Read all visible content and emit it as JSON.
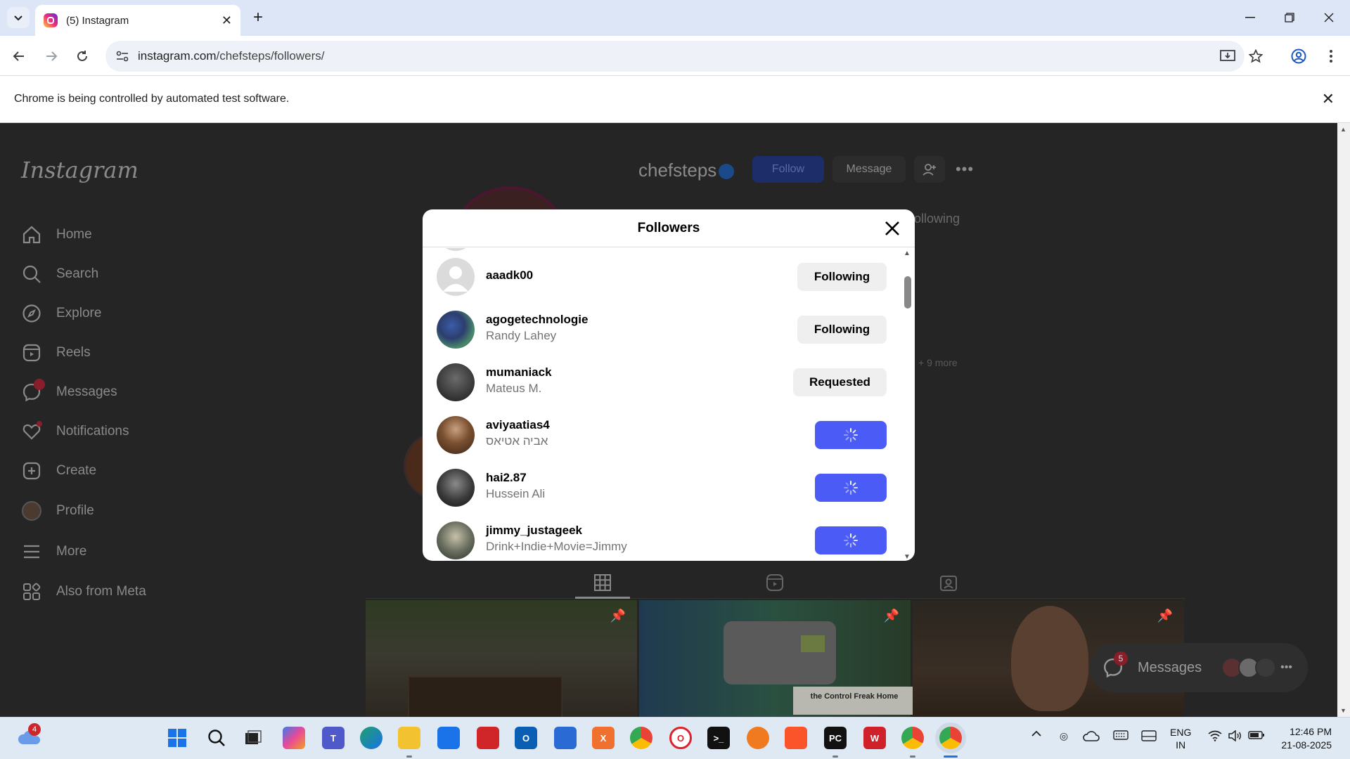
{
  "browser": {
    "tab_title": "(5) Instagram",
    "url_host": "instagram.com",
    "url_path": "/chefsteps/followers/",
    "infobar_text": "Chrome is being controlled by automated test software."
  },
  "instagram": {
    "logo": "Instagram",
    "nav": [
      {
        "label": "Home",
        "icon": "home-icon"
      },
      {
        "label": "Search",
        "icon": "search-icon"
      },
      {
        "label": "Explore",
        "icon": "compass-icon"
      },
      {
        "label": "Reels",
        "icon": "reels-icon"
      },
      {
        "label": "Messages",
        "icon": "messenger-icon",
        "badge": "5"
      },
      {
        "label": "Notifications",
        "icon": "heart-icon"
      },
      {
        "label": "Create",
        "icon": "plus-square-icon"
      },
      {
        "label": "Profile",
        "icon": "avatar-icon"
      },
      {
        "label": "More",
        "icon": "hamburger-icon"
      },
      {
        "label": "Also from Meta",
        "icon": "meta-apps-icon"
      }
    ],
    "profile": {
      "username": "chefsteps",
      "follow_label": "Follow",
      "message_label": "Message",
      "following_label": "ollowing",
      "more_text": "+ 9 more"
    },
    "post_caption": "the Control Freak Home",
    "messages_pill": {
      "label": "Messages",
      "badge": "5"
    }
  },
  "modal": {
    "title": "Followers",
    "rows": [
      {
        "username": "aaadk00",
        "fullname": "",
        "button": "Following",
        "button_state": "gray"
      },
      {
        "username": "agogetechnologie",
        "fullname": "Randy Lahey",
        "button": "Following",
        "button_state": "gray"
      },
      {
        "username": "mumaniack",
        "fullname": "Mateus M.",
        "button": "Requested",
        "button_state": "gray"
      },
      {
        "username": "aviyaatias4",
        "fullname": "אביה אטיאס",
        "button": "",
        "button_state": "loading"
      },
      {
        "username": "hai2.87",
        "fullname": "Hussein Ali",
        "button": "",
        "button_state": "loading"
      },
      {
        "username": "jimmy_justageek",
        "fullname": "Drink+Indie+Movie=Jimmy",
        "button": "",
        "button_state": "loading"
      }
    ]
  },
  "taskbar": {
    "weather_badge": "4",
    "lang_line1": "ENG",
    "lang_line2": "IN",
    "time": "12:46 PM",
    "date": "21-08-2025"
  },
  "colors": {
    "instagram_blue": "#4a5cf5",
    "overlay": "#252525",
    "tab_strip": "#dce6f7"
  }
}
